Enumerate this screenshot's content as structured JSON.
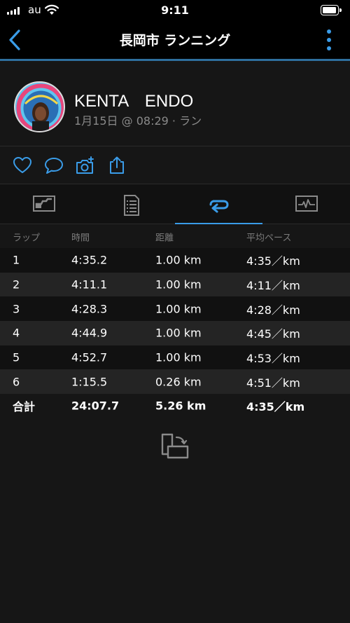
{
  "status_bar": {
    "carrier": "au",
    "time": "9:11",
    "battery_level": 0.95
  },
  "nav": {
    "title": "長岡市 ランニング"
  },
  "profile": {
    "name": "KENTA　ENDO",
    "meta": "1月15日 @ 08:29 · ラン"
  },
  "actions": [
    "heart-icon",
    "comment-icon",
    "add-photo-icon",
    "share-icon"
  ],
  "tabs": [
    {
      "icon": "stats-icon",
      "selected": false
    },
    {
      "icon": "details-icon",
      "selected": false
    },
    {
      "icon": "laps-icon",
      "selected": true
    },
    {
      "icon": "chart-icon",
      "selected": false
    }
  ],
  "laps": {
    "headers": [
      "ラップ",
      "時間",
      "距離",
      "平均ペース"
    ],
    "rows": [
      [
        "1",
        "4:35.2",
        "1.00 km",
        "4:35／km"
      ],
      [
        "2",
        "4:11.1",
        "1.00 km",
        "4:11／km"
      ],
      [
        "3",
        "4:28.3",
        "1.00 km",
        "4:28／km"
      ],
      [
        "4",
        "4:44.9",
        "1.00 km",
        "4:45／km"
      ],
      [
        "5",
        "4:52.7",
        "1.00 km",
        "4:53／km"
      ],
      [
        "6",
        "1:15.5",
        "0.26 km",
        "4:51／km"
      ]
    ],
    "total": [
      "合計",
      "24:07.7",
      "5.26 km",
      "4:35／km"
    ]
  },
  "colors": {
    "accent": "#3a9ce8",
    "background": "#161616",
    "row_alt": "#242424",
    "muted": "#8a8a8a"
  }
}
